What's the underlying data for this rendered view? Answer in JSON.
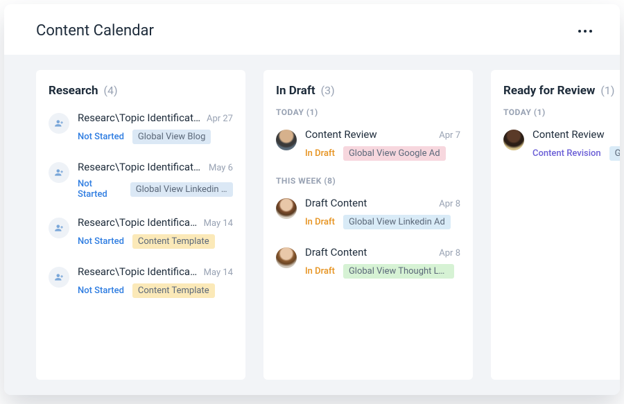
{
  "header": {
    "title": "Content Calendar"
  },
  "columns": [
    {
      "title": "Research",
      "count": "(4)",
      "sections": [
        {
          "label": null,
          "cards": [
            {
              "avatar_type": "placeholder",
              "avatar_bg": "",
              "title": "Researc\\Topic Identificat…",
              "date": "Apr 27",
              "status_text": "Not Started",
              "status_class": "not-started",
              "tag_text": "Global View Blog",
              "tag_class": "blue"
            },
            {
              "avatar_type": "placeholder",
              "avatar_bg": "",
              "title": "Researc\\Topic Identificat…",
              "date": "May 6",
              "status_text": "Not Started",
              "status_class": "not-started",
              "tag_text": "Global View Linkedin Ad",
              "tag_class": "blue"
            },
            {
              "avatar_type": "placeholder",
              "avatar_bg": "",
              "title": "Researc\\Topic Identifica…",
              "date": "May 14",
              "status_text": "Not Started",
              "status_class": "not-started",
              "tag_text": "Content Template",
              "tag_class": "yellow"
            },
            {
              "avatar_type": "placeholder",
              "avatar_bg": "",
              "title": "Researc\\Topic Identifica…",
              "date": "May 14",
              "status_text": "Not Started",
              "status_class": "not-started",
              "tag_text": "Content Template",
              "tag_class": "yellow"
            }
          ]
        }
      ]
    },
    {
      "title": "In Draft",
      "count": "(3)",
      "sections": [
        {
          "label": "TODAY (1)",
          "cards": [
            {
              "avatar_type": "person",
              "avatar_bg": "radial-gradient(circle at 50% 30%, #d6b18c 0%, #d6b18c 35%, #3a3a3a 45%, #3a3a3a 60%, #5a6b7a 70%)",
              "title": "Content Review",
              "date": "Apr 7",
              "status_text": "In Draft",
              "status_class": "in-draft",
              "tag_text": "Global View Google Ad",
              "tag_class": "pink"
            }
          ]
        },
        {
          "label": "THIS WEEK (8)",
          "cards": [
            {
              "avatar_type": "person",
              "avatar_bg": "radial-gradient(circle at 50% 32%, #e8c7a8 0%, #e8c7a8 32%, #7a4a2a 42%, #5a3a20 58%, #d8d0c4 72%)",
              "title": "Draft Content",
              "date": "Apr 8",
              "status_text": "In Draft",
              "status_class": "in-draft",
              "tag_text": "Global View Linkedin Ad",
              "tag_class": "lightblue"
            },
            {
              "avatar_type": "person",
              "avatar_bg": "radial-gradient(circle at 50% 30%, #e9c8a9 0%, #e9c8a9 32%, #8a5a30 42%, #6a4524 58%, #cfc7bb 72%)",
              "title": "Draft Content",
              "date": "Apr 8",
              "status_text": "In Draft",
              "status_class": "in-draft",
              "tag_text": "Global View Thought Lea…",
              "tag_class": "green"
            }
          ]
        }
      ]
    },
    {
      "title": "Ready for Review",
      "count": "(1)",
      "sections": [
        {
          "label": "TODAY (1)",
          "cards": [
            {
              "avatar_type": "person",
              "avatar_bg": "radial-gradient(circle at 50% 30%, #5a3a28 0%, #5a3a28 34%, #2b1e16 44%, #2b1e16 58%, #d6c28a 72%)",
              "title": "Content Review",
              "date": "",
              "status_text": "Content Revision",
              "status_class": "revision",
              "tag_text": "Glo",
              "tag_class": "lightblue"
            }
          ]
        }
      ]
    }
  ]
}
